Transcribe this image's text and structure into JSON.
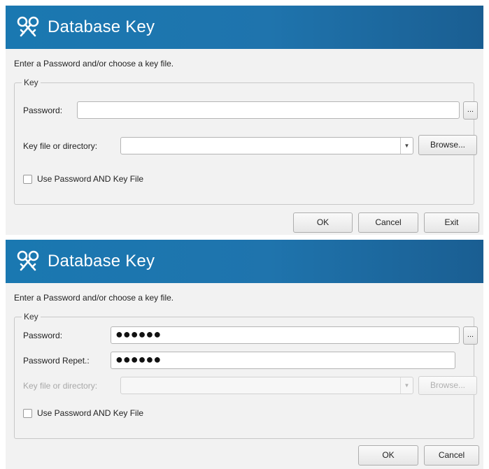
{
  "dialogs": [
    {
      "title": "Database Key",
      "instructions": "Enter a Password and/or choose a key file.",
      "group_legend": "Key",
      "password_label": "Password:",
      "password_value": "",
      "password_toggle": "...",
      "keyfile_label": "Key file or directory:",
      "keyfile_value": "",
      "browse_label": "Browse...",
      "checkbox_label": "Use Password AND Key File",
      "checkbox_checked": false,
      "ok_label": "OK",
      "cancel_label": "Cancel",
      "exit_label": "Exit"
    },
    {
      "title": "Database Key",
      "instructions": "Enter a Password and/or choose a key file.",
      "group_legend": "Key",
      "password_label": "Password:",
      "password_value": "●●●●●●",
      "password_toggle": "...",
      "password_repeat_label": "Password Repet.:",
      "password_repeat_value": "●●●●●●",
      "keyfile_label": "Key file or directory:",
      "keyfile_value": "",
      "browse_label": "Browse...",
      "checkbox_label": "Use Password AND Key File",
      "checkbox_checked": false,
      "ok_label": "OK",
      "cancel_label": "Cancel"
    }
  ],
  "icons": {
    "app_logo": "keepass-logo-icon",
    "dropdown": "chevron-down-icon"
  },
  "colors": {
    "header_blue": "#1a78b1",
    "dialog_bg": "#f2f2f2"
  }
}
